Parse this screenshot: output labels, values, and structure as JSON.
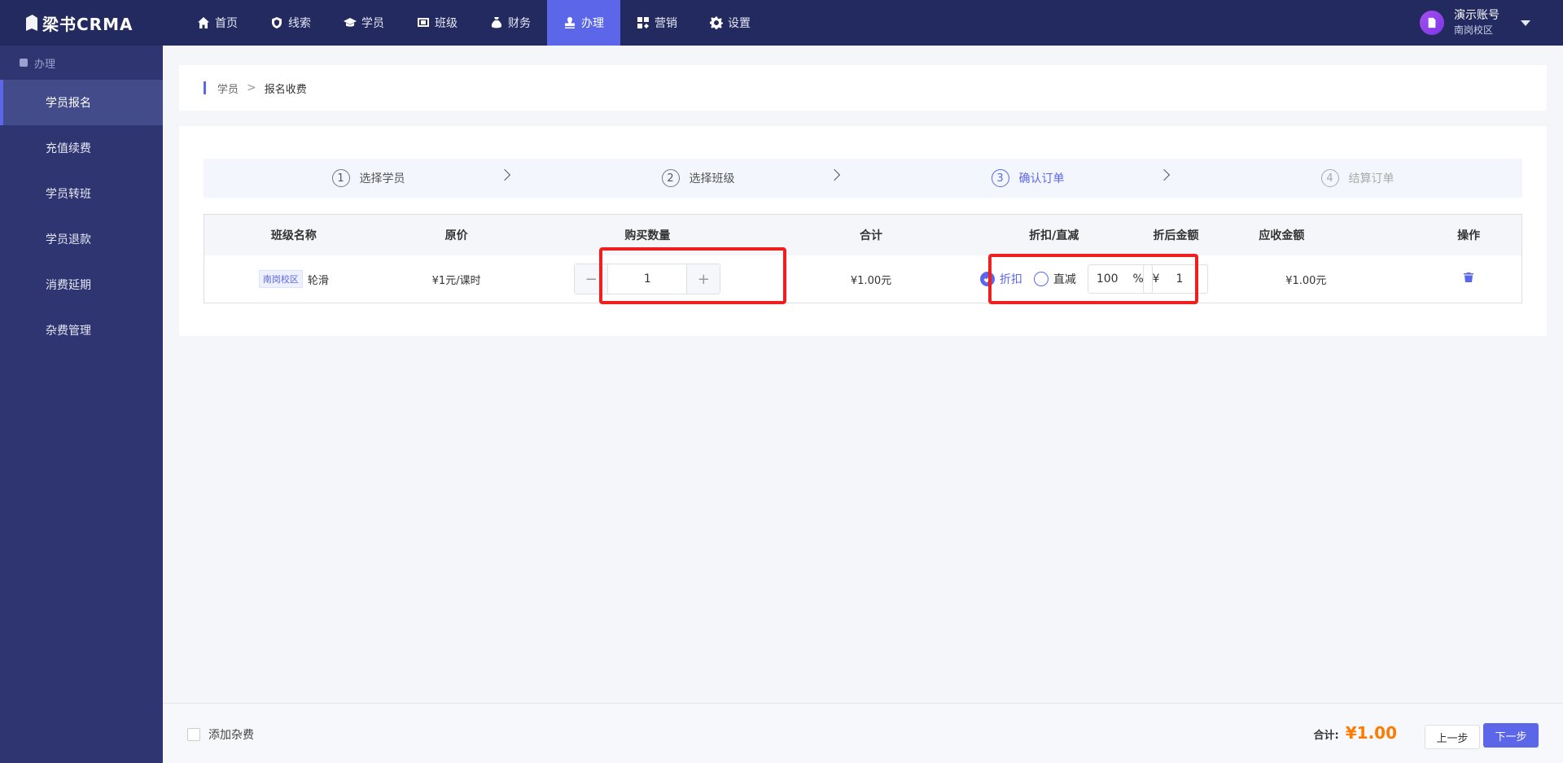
{
  "app": {
    "logo_text": "梁书CRMA"
  },
  "nav": [
    {
      "label": "首页",
      "icon": "home-icon"
    },
    {
      "label": "线索",
      "icon": "shield-icon"
    },
    {
      "label": "学员",
      "icon": "graduation-cap-icon"
    },
    {
      "label": "班级",
      "icon": "board-icon"
    },
    {
      "label": "财务",
      "icon": "money-bag-icon"
    },
    {
      "label": "办理",
      "icon": "stamp-icon",
      "active": true
    },
    {
      "label": "营销",
      "icon": "marketing-icon"
    },
    {
      "label": "设置",
      "icon": "gear-icon"
    }
  ],
  "user": {
    "name": "演示账号",
    "campus": "南岗校区"
  },
  "sidebar": {
    "header": "办理",
    "items": [
      {
        "label": "学员报名",
        "active": true
      },
      {
        "label": "充值续费"
      },
      {
        "label": "学员转班"
      },
      {
        "label": "学员退款"
      },
      {
        "label": "消费延期"
      },
      {
        "label": "杂费管理"
      }
    ]
  },
  "breadcrumb": {
    "parent": "学员",
    "current": "报名收费"
  },
  "steps": [
    {
      "num": "1",
      "label": "选择学员"
    },
    {
      "num": "2",
      "label": "选择班级"
    },
    {
      "num": "3",
      "label": "确认订单",
      "active": true
    },
    {
      "num": "4",
      "label": "结算订单"
    }
  ],
  "table": {
    "headers": [
      "班级名称",
      "原价",
      "购买数量",
      "合计",
      "折扣/直减",
      "折后金额",
      "应收金额",
      "操作"
    ],
    "row": {
      "campus_tag": "南岗校区",
      "class_name": "轮滑",
      "price": "¥1元/课时",
      "quantity": "1",
      "minus": "−",
      "plus": "+",
      "total": "¥1.00元",
      "discount_label": "折扣",
      "reduce_label": "直减",
      "discount_value": "100",
      "percent": "%",
      "after_currency": "¥",
      "after_value": "1",
      "receivable": "¥1.00元"
    }
  },
  "footer": {
    "add_fee_label": "添加杂费",
    "total_label": "合计:",
    "total_amount": "¥1.00",
    "prev_label": "上一步",
    "next_label": "下一步"
  }
}
